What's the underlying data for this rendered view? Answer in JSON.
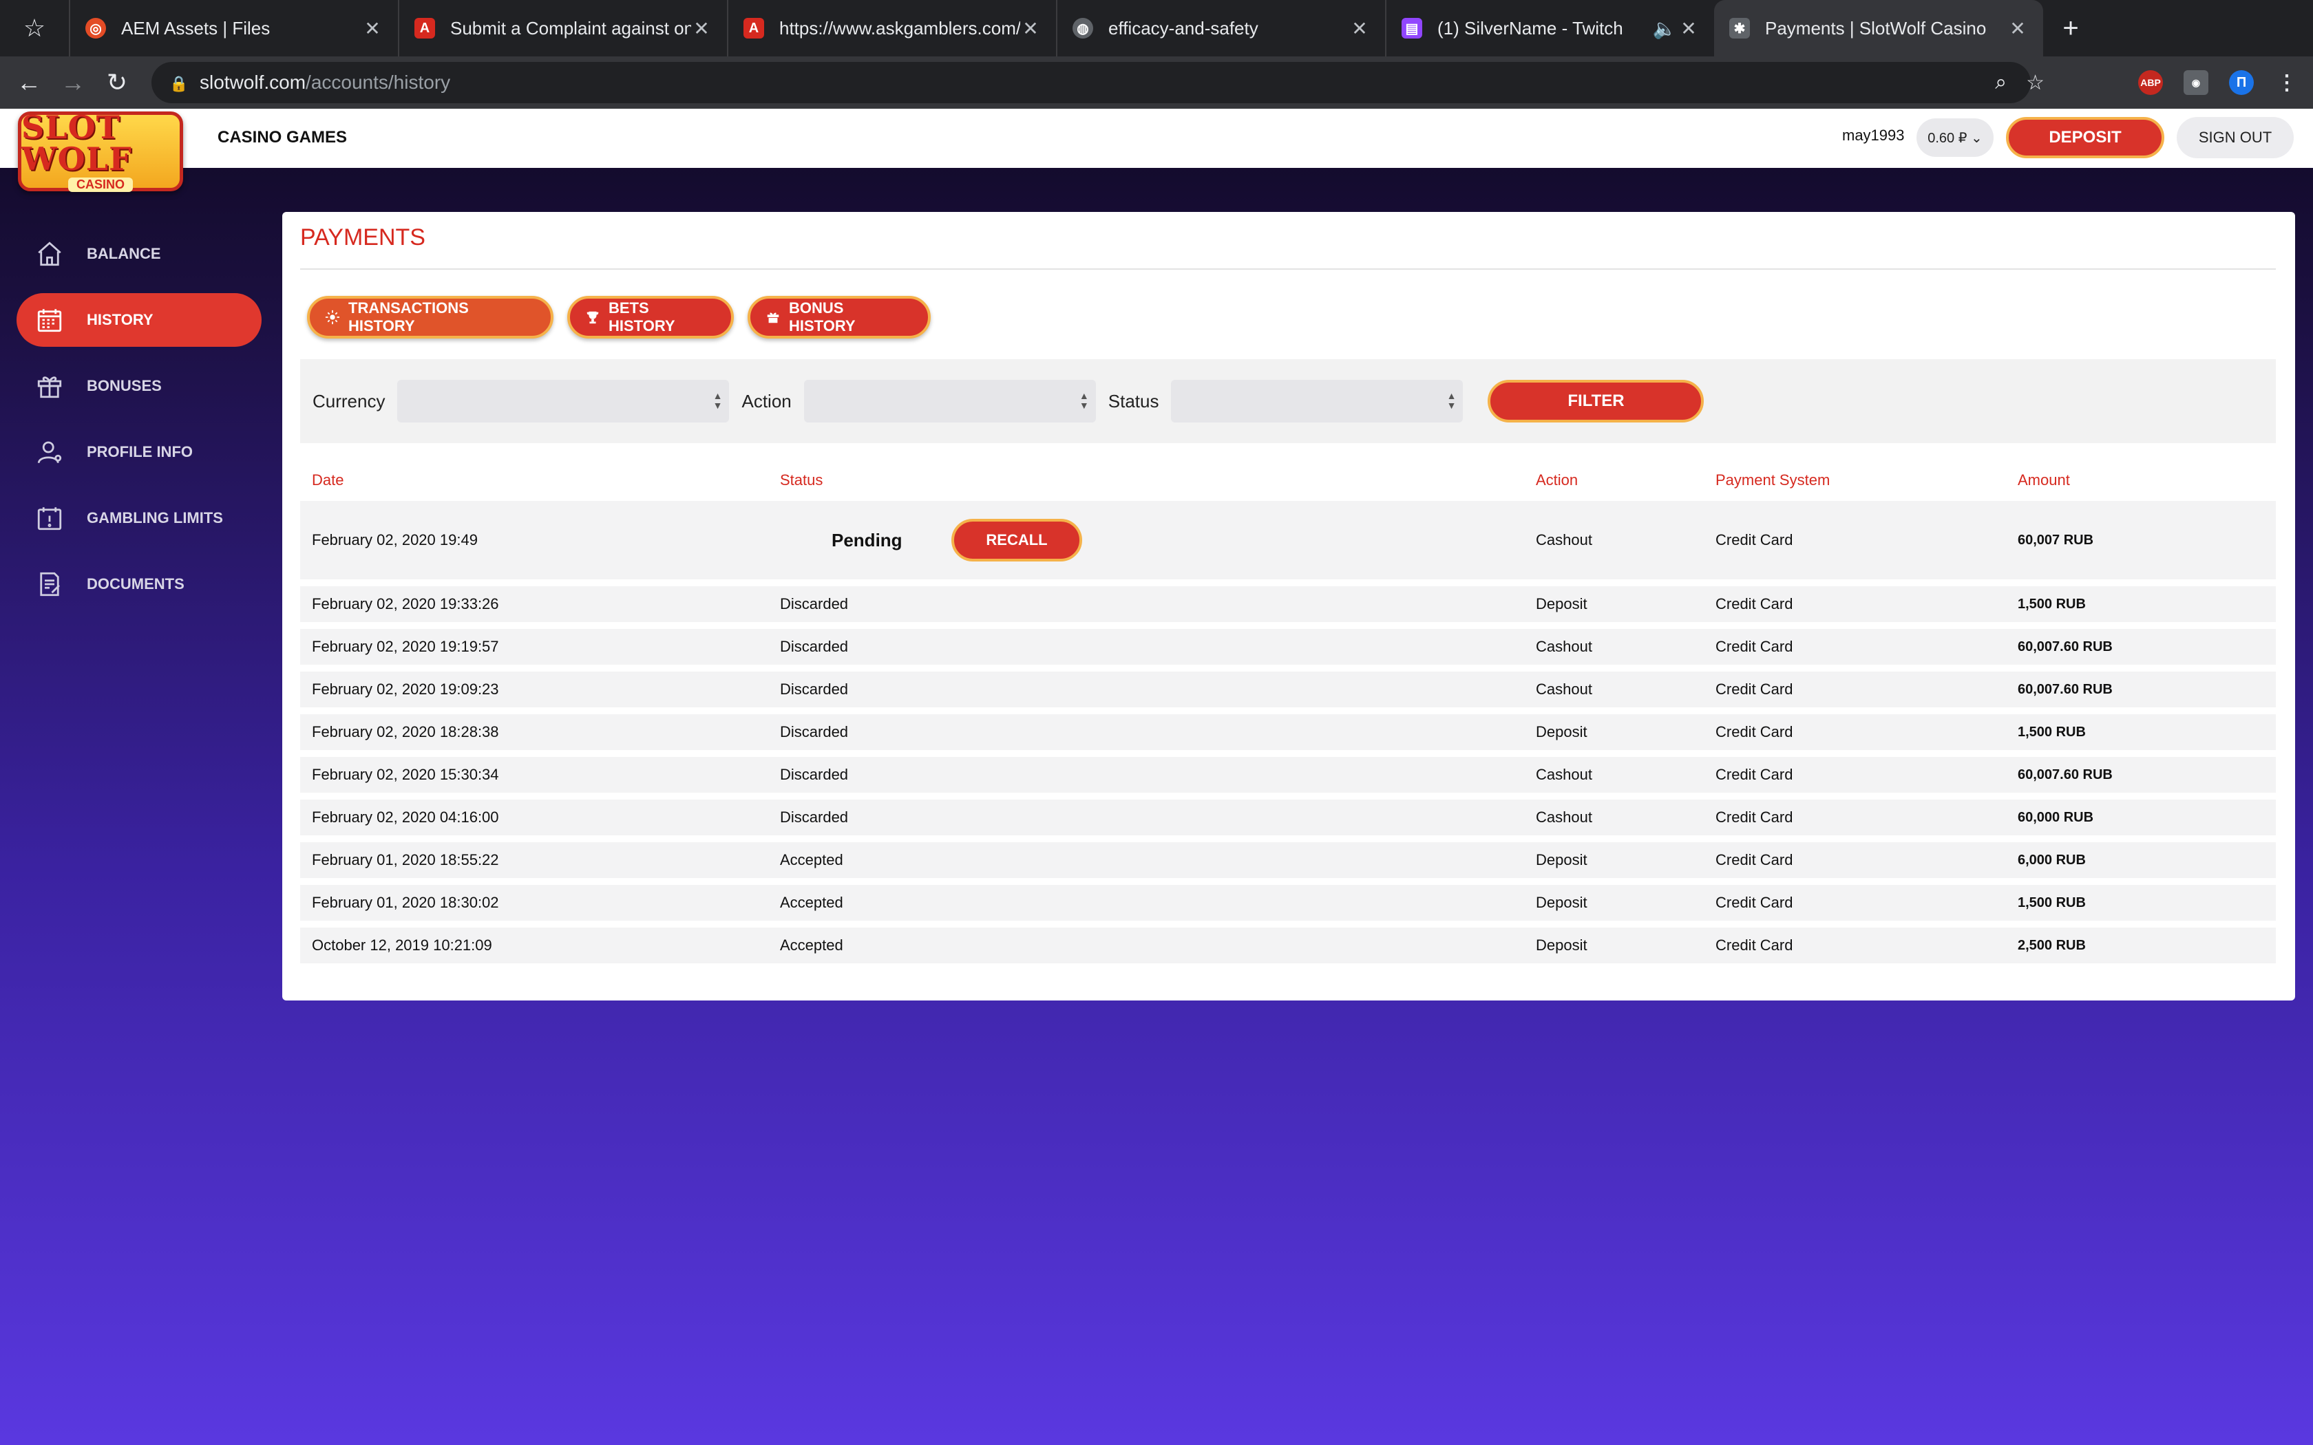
{
  "browser": {
    "tabs": [
      {
        "title": "AEM Assets | Files",
        "icon": "aem-icon",
        "color": "#e34c26"
      },
      {
        "title": "Submit a Complaint against onlin",
        "icon": "askgamblers-icon",
        "color": "#d6291f"
      },
      {
        "title": "https://www.askgamblers.com/c",
        "icon": "askgamblers-icon",
        "color": "#d6291f"
      },
      {
        "title": "efficacy-and-safety",
        "icon": "globe-icon",
        "color": "#5f6368"
      },
      {
        "title": "(1) SilverName - Twitch",
        "icon": "twitch-icon",
        "color": "#9146ff"
      },
      {
        "title": "Payments | SlotWolf Casino",
        "icon": "slotwolf-icon",
        "color": "#bdc1c6"
      }
    ],
    "url_host": "slotwolf.com",
    "url_path": "/accounts/history",
    "ext_abp": "ABP",
    "ext_profile": "П"
  },
  "header": {
    "logo_main": "SLOT WOLF",
    "logo_sub": "CASINO",
    "nav_casino": "CASINO GAMES",
    "username": "may1993",
    "balance": "0.60 ₽ ⌄",
    "deposit": "DEPOSIT",
    "signout": "SIGN OUT"
  },
  "sidebar": {
    "items": [
      {
        "label": "BALANCE",
        "icon": "house-icon"
      },
      {
        "label": "HISTORY",
        "icon": "calendar-icon"
      },
      {
        "label": "BONUSES",
        "icon": "gift-icon"
      },
      {
        "label": "PROFILE INFO",
        "icon": "user-icon"
      },
      {
        "label": "GAMBLING LIMITS",
        "icon": "limits-icon"
      },
      {
        "label": "DOCUMENTS",
        "icon": "document-icon"
      }
    ]
  },
  "payments": {
    "title": "PAYMENTS",
    "tabs": [
      {
        "label": "TRANSACTIONS HISTORY",
        "icon": "gear-icon"
      },
      {
        "label": "BETS HISTORY",
        "icon": "trophy-icon"
      },
      {
        "label": "BONUS HISTORY",
        "icon": "gift-icon"
      }
    ],
    "filter": {
      "currency_label": "Currency",
      "action_label": "Action",
      "status_label": "Status",
      "button": "FILTER"
    },
    "columns": {
      "date": "Date",
      "status": "Status",
      "action": "Action",
      "payment_system": "Payment System",
      "amount": "Amount"
    },
    "recall_label": "RECALL",
    "rows": [
      {
        "date": "February 02, 2020 19:49",
        "status": "Pending",
        "action": "Cashout",
        "ps": "Credit Card",
        "amount": "60,007 RUB"
      },
      {
        "date": "February 02, 2020 19:33:26",
        "status": "Discarded",
        "action": "Deposit",
        "ps": "Credit Card",
        "amount": "1,500 RUB"
      },
      {
        "date": "February 02, 2020 19:19:57",
        "status": "Discarded",
        "action": "Cashout",
        "ps": "Credit Card",
        "amount": "60,007.60 RUB"
      },
      {
        "date": "February 02, 2020 19:09:23",
        "status": "Discarded",
        "action": "Cashout",
        "ps": "Credit Card",
        "amount": "60,007.60 RUB"
      },
      {
        "date": "February 02, 2020 18:28:38",
        "status": "Discarded",
        "action": "Deposit",
        "ps": "Credit Card",
        "amount": "1,500 RUB"
      },
      {
        "date": "February 02, 2020 15:30:34",
        "status": "Discarded",
        "action": "Cashout",
        "ps": "Credit Card",
        "amount": "60,007.60 RUB"
      },
      {
        "date": "February 02, 2020 04:16:00",
        "status": "Discarded",
        "action": "Cashout",
        "ps": "Credit Card",
        "amount": "60,000 RUB"
      },
      {
        "date": "February 01, 2020 18:55:22",
        "status": "Accepted",
        "action": "Deposit",
        "ps": "Credit Card",
        "amount": "6,000 RUB"
      },
      {
        "date": "February 01, 2020 18:30:02",
        "status": "Accepted",
        "action": "Deposit",
        "ps": "Credit Card",
        "amount": "1,500 RUB"
      },
      {
        "date": "October 12, 2019 10:21:09",
        "status": "Accepted",
        "action": "Deposit",
        "ps": "Credit Card",
        "amount": "2,500 RUB"
      }
    ]
  },
  "colors": {
    "accent": "#d8332a",
    "accent_border": "#f5b24a",
    "title_red": "#d6291f"
  }
}
